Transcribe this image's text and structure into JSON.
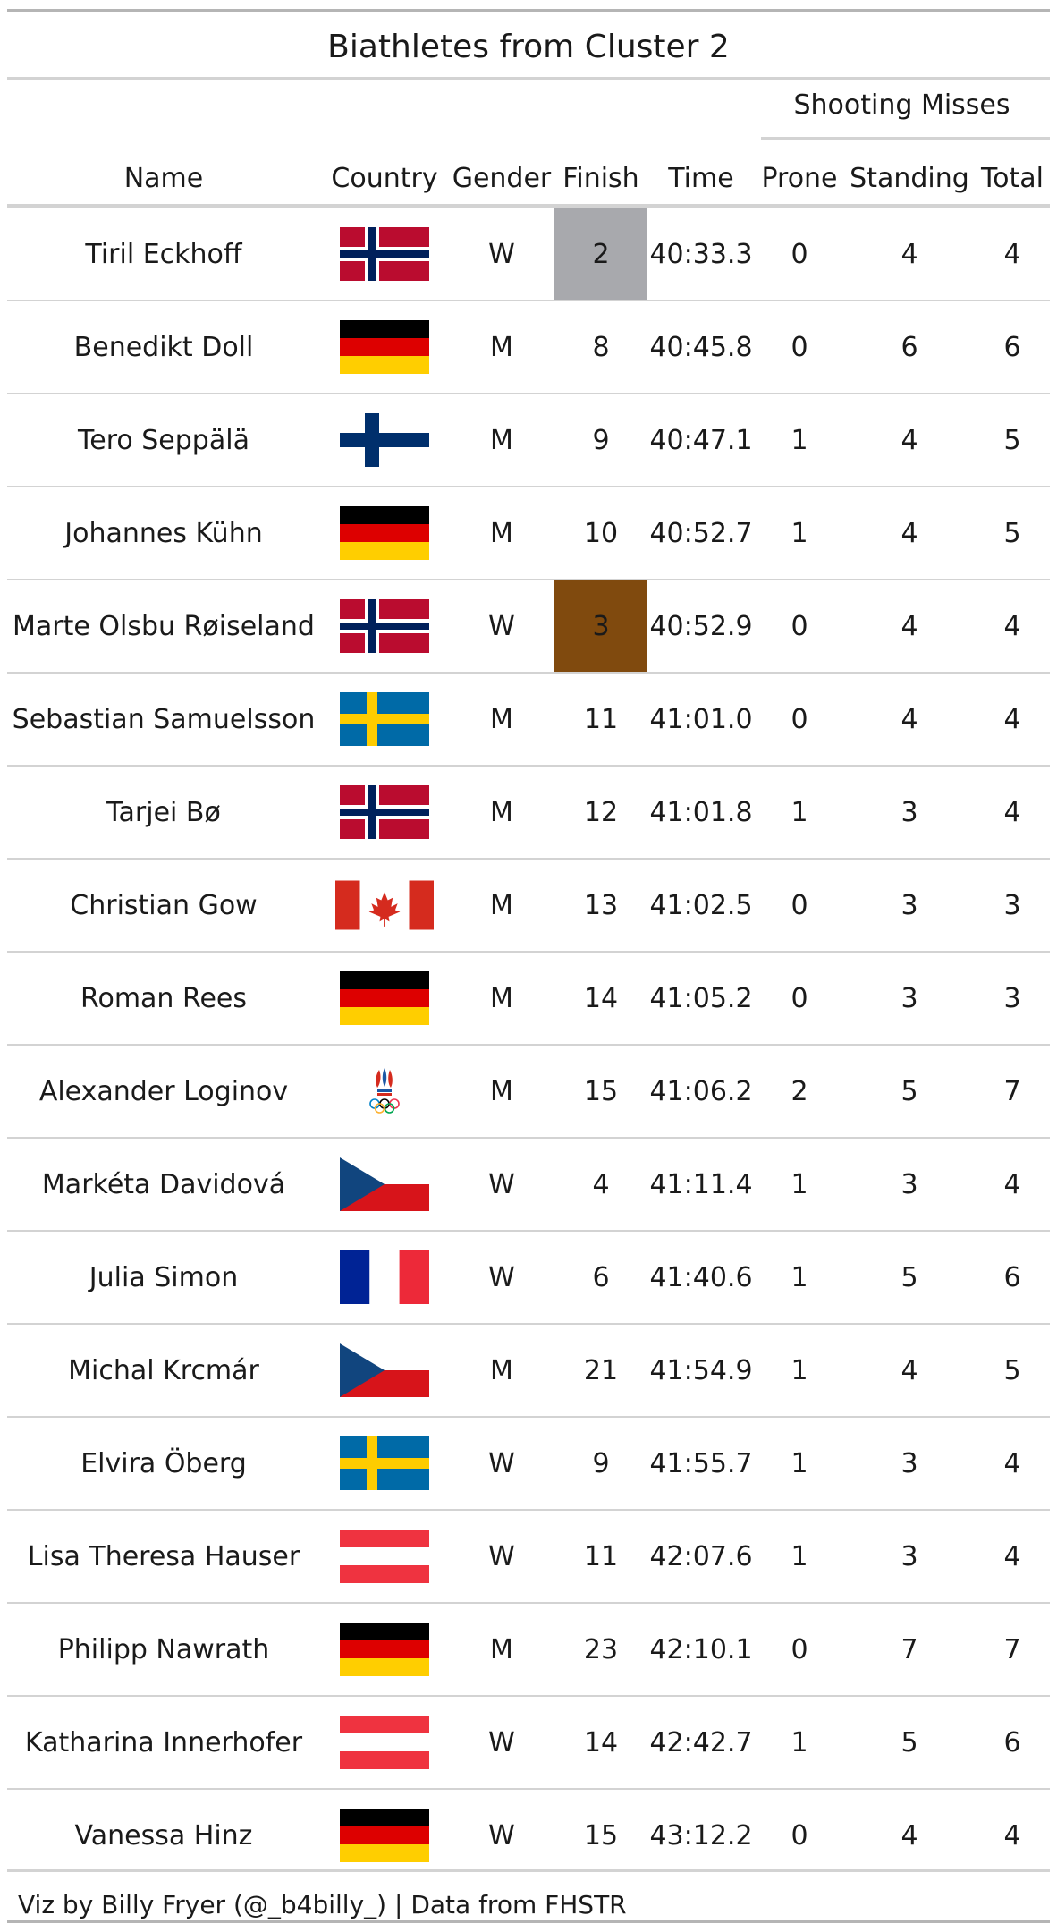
{
  "title": "Biathletes from Cluster 2",
  "spanner_label": "Shooting Misses",
  "columns": {
    "name": "Name",
    "country": "Country",
    "gender": "Gender",
    "finish": "Finish",
    "time": "Time",
    "prone": "Prone",
    "standing": "Standing",
    "total": "Total"
  },
  "colors": {
    "silver": "#a8a9ad",
    "bronze": "#804a0e",
    "rule": "#c8c8c8",
    "divider": "#d3d3d3"
  },
  "chart_data": {
    "type": "table",
    "title": "Biathletes from Cluster 2",
    "columns": [
      "Name",
      "Country",
      "Gender",
      "Finish",
      "Time",
      "Prone",
      "Standing",
      "Total"
    ],
    "rows": [
      {
        "name": "Tiril Eckhoff",
        "country": "norway-flag",
        "gender": "W",
        "finish": "2",
        "time": "40:33.3",
        "prone": "0",
        "standing": "4",
        "total": "4",
        "medal": "silver"
      },
      {
        "name": "Benedikt Doll",
        "country": "germany-flag",
        "gender": "M",
        "finish": "8",
        "time": "40:45.8",
        "prone": "0",
        "standing": "6",
        "total": "6",
        "medal": ""
      },
      {
        "name": "Tero Seppälä",
        "country": "finland-flag",
        "gender": "M",
        "finish": "9",
        "time": "40:47.1",
        "prone": "1",
        "standing": "4",
        "total": "5",
        "medal": ""
      },
      {
        "name": "Johannes Kühn",
        "country": "germany-flag",
        "gender": "M",
        "finish": "10",
        "time": "40:52.7",
        "prone": "1",
        "standing": "4",
        "total": "5",
        "medal": ""
      },
      {
        "name": "Marte Olsbu Røiseland",
        "country": "norway-flag",
        "gender": "W",
        "finish": "3",
        "time": "40:52.9",
        "prone": "0",
        "standing": "4",
        "total": "4",
        "medal": "bronze"
      },
      {
        "name": "Sebastian Samuelsson",
        "country": "sweden-flag",
        "gender": "M",
        "finish": "11",
        "time": "41:01.0",
        "prone": "0",
        "standing": "4",
        "total": "4",
        "medal": ""
      },
      {
        "name": "Tarjei Bø",
        "country": "norway-flag",
        "gender": "M",
        "finish": "12",
        "time": "41:01.8",
        "prone": "1",
        "standing": "3",
        "total": "4",
        "medal": ""
      },
      {
        "name": "Christian Gow",
        "country": "canada-flag",
        "gender": "M",
        "finish": "13",
        "time": "41:02.5",
        "prone": "0",
        "standing": "3",
        "total": "3",
        "medal": ""
      },
      {
        "name": "Roman Rees",
        "country": "germany-flag",
        "gender": "M",
        "finish": "14",
        "time": "41:05.2",
        "prone": "0",
        "standing": "3",
        "total": "3",
        "medal": ""
      },
      {
        "name": "Alexander Loginov",
        "country": "roc-emblem",
        "gender": "M",
        "finish": "15",
        "time": "41:06.2",
        "prone": "2",
        "standing": "5",
        "total": "7",
        "medal": ""
      },
      {
        "name": "Markéta Davidová",
        "country": "czech-flag",
        "gender": "W",
        "finish": "4",
        "time": "41:11.4",
        "prone": "1",
        "standing": "3",
        "total": "4",
        "medal": ""
      },
      {
        "name": "Julia Simon",
        "country": "france-flag",
        "gender": "W",
        "finish": "6",
        "time": "41:40.6",
        "prone": "1",
        "standing": "5",
        "total": "6",
        "medal": ""
      },
      {
        "name": "Michal Krcmár",
        "country": "czech-flag",
        "gender": "M",
        "finish": "21",
        "time": "41:54.9",
        "prone": "1",
        "standing": "4",
        "total": "5",
        "medal": ""
      },
      {
        "name": "Elvira Öberg",
        "country": "sweden-flag",
        "gender": "W",
        "finish": "9",
        "time": "41:55.7",
        "prone": "1",
        "standing": "3",
        "total": "4",
        "medal": ""
      },
      {
        "name": "Lisa Theresa Hauser",
        "country": "austria-flag",
        "gender": "W",
        "finish": "11",
        "time": "42:07.6",
        "prone": "1",
        "standing": "3",
        "total": "4",
        "medal": ""
      },
      {
        "name": "Philipp Nawrath",
        "country": "germany-flag",
        "gender": "M",
        "finish": "23",
        "time": "42:10.1",
        "prone": "0",
        "standing": "7",
        "total": "7",
        "medal": ""
      },
      {
        "name": "Katharina Innerhofer",
        "country": "austria-flag",
        "gender": "W",
        "finish": "14",
        "time": "42:42.7",
        "prone": "1",
        "standing": "5",
        "total": "6",
        "medal": ""
      },
      {
        "name": "Vanessa Hinz",
        "country": "germany-flag",
        "gender": "W",
        "finish": "15",
        "time": "43:12.2",
        "prone": "0",
        "standing": "4",
        "total": "4",
        "medal": ""
      }
    ]
  },
  "footer": "Viz by Billy Fryer (@_b4billy_) | Data from FHSTR"
}
